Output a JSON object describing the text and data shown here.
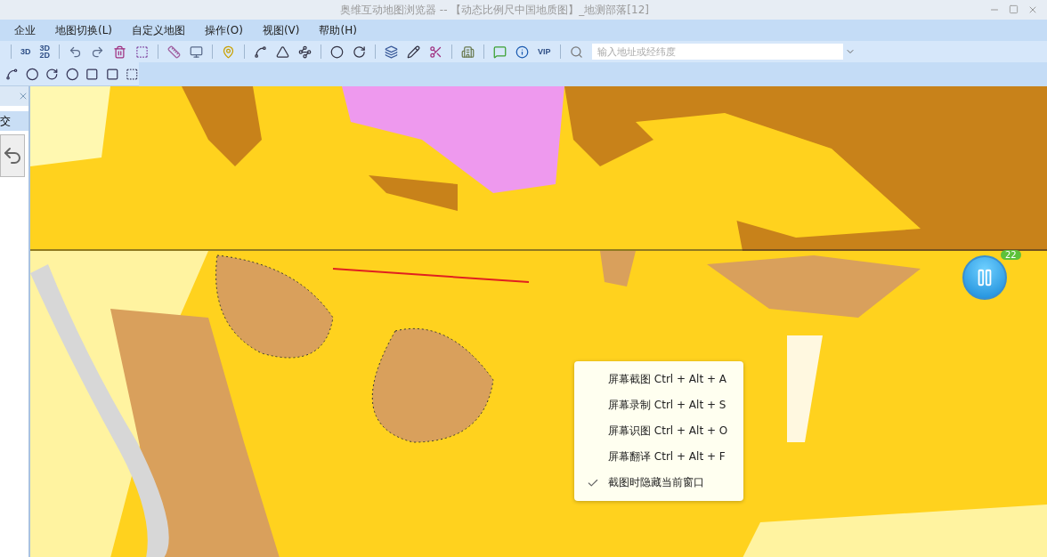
{
  "window": {
    "title": "奥维互动地图浏览器 -- 【动态比例尺中国地质图】_地测部落[12]"
  },
  "menu": [
    "企业",
    "地图切换(L)",
    "自定义地图",
    "操作(O)",
    "视图(V)",
    "帮助(H)"
  ],
  "toolbar": {
    "view_buttons": [
      "3D",
      "3D\n2D"
    ],
    "vip": "VIP",
    "search": {
      "placeholder": "输入地址或经纬度"
    }
  },
  "side_panel": {
    "items": [
      {
        "label": "交",
        "selected": true
      }
    ]
  },
  "float_ball": {
    "badge": "22"
  },
  "context_menu": [
    {
      "label": "屏幕截图 Ctrl + Alt + A",
      "checked": false
    },
    {
      "label": "屏幕录制 Ctrl + Alt + S",
      "checked": false
    },
    {
      "label": "屏幕识图 Ctrl + Alt + O",
      "checked": false
    },
    {
      "label": "屏幕翻译 Ctrl + Alt + F",
      "checked": false
    },
    {
      "label": "截图时隐藏当前窗口",
      "checked": true
    }
  ]
}
